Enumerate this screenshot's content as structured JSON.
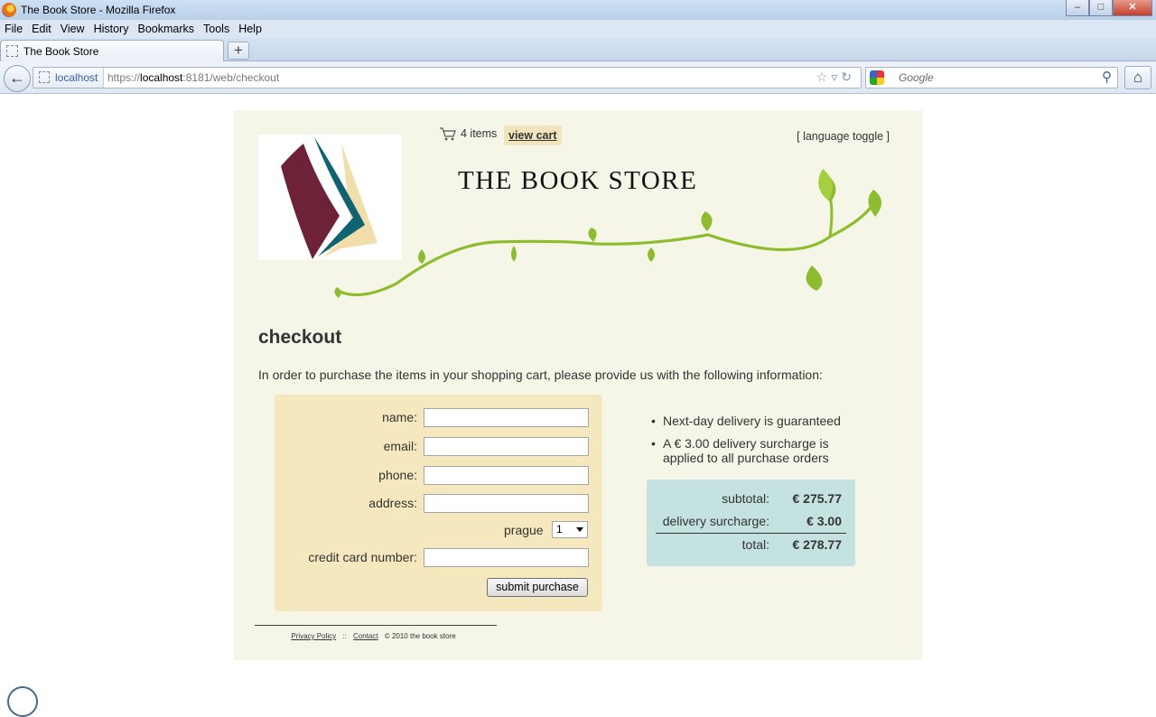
{
  "window": {
    "title": "The Book Store - Mozilla Firefox"
  },
  "menu": [
    "File",
    "Edit",
    "View",
    "History",
    "Bookmarks",
    "Tools",
    "Help"
  ],
  "tabs": [
    {
      "label": "The Book Store"
    }
  ],
  "nav": {
    "identity": "localhost",
    "url_prefix": "https://",
    "url_host": "localhost",
    "url_rest": ":8181/web/checkout",
    "search_placeholder": "Google"
  },
  "header": {
    "cart_count": "4 items",
    "view_cart": "view cart",
    "language_toggle": "[ language toggle ]",
    "store_title": "THE BOOK STORE"
  },
  "checkout": {
    "title": "checkout",
    "intro": "In order to purchase the items in your shopping cart, please provide us with the following information:",
    "fields": {
      "name": "name:",
      "email": "email:",
      "phone": "phone:",
      "address": "address:",
      "city": "prague",
      "city_select": "1",
      "credit_card": "credit card number:"
    },
    "submit": "submit purchase",
    "info": [
      "Next-day delivery is guaranteed",
      "A € 3.00 delivery surcharge is applied to all purchase orders"
    ],
    "totals": {
      "subtotal_label": "subtotal:",
      "subtotal": "€ 275.77",
      "surcharge_label": "delivery surcharge:",
      "surcharge": "€ 3.00",
      "total_label": "total:",
      "total": "€ 278.77"
    }
  },
  "footer": {
    "privacy": "Privacy Policy",
    "separator": "::",
    "contact": "Contact",
    "copyright": "© 2010 the book store"
  },
  "colors": {
    "page_bg": "#f5f5e8",
    "form_bg": "#f5e8bf",
    "totals_bg": "#c4e2e0",
    "vine": "#8dbd2c",
    "book_red": "#6e2238",
    "book_teal": "#0e6470",
    "book_cream": "#f1deaa"
  }
}
